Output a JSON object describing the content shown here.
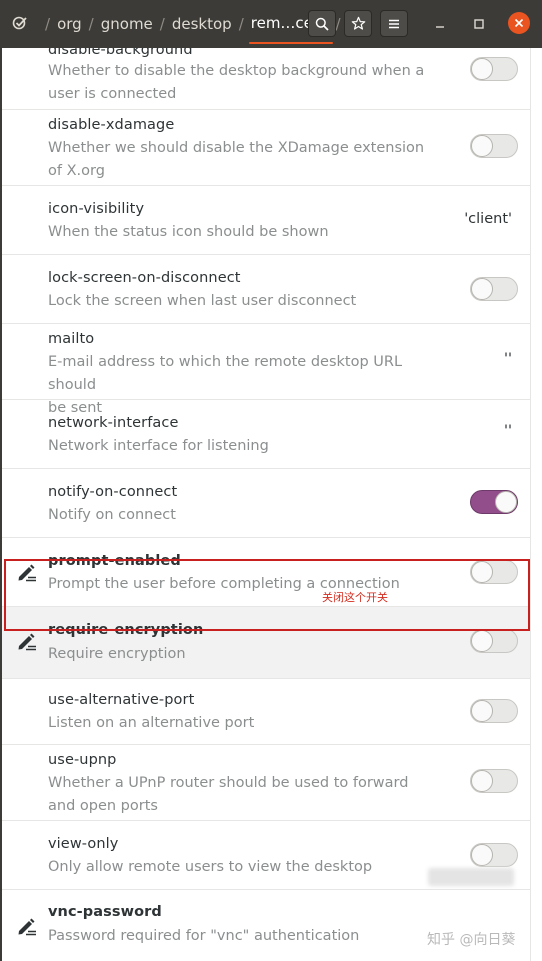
{
  "header": {
    "path": [
      "org",
      "gnome",
      "desktop"
    ],
    "current": "rem…cess",
    "search_icon": "search-icon",
    "star_icon": "star-icon",
    "menu_icon": "hamburger-menu-icon",
    "accent": "#e95420"
  },
  "rows": {
    "disable_background": {
      "name": "disable-background",
      "desc_line1": "Whether to disable the desktop background when a",
      "desc_line2": "user is connected",
      "state": "off"
    },
    "disable_xdamage": {
      "name": "disable-xdamage",
      "desc_line1": "Whether we should disable the XDamage extension",
      "desc_line2": "of X.org",
      "state": "off"
    },
    "icon_visibility": {
      "name": "icon-visibility",
      "desc": "When the status icon should be shown",
      "value": "'client'"
    },
    "lock_screen": {
      "name": "lock-screen-on-disconnect",
      "desc": "Lock the screen when last user disconnect",
      "state": "off"
    },
    "mailto": {
      "name": "mailto",
      "desc_line1": "E-mail address to which the remote desktop URL should",
      "desc_line2": "be sent",
      "value": "''"
    },
    "network_interface": {
      "name": "network-interface",
      "desc": "Network interface for listening",
      "value": "''"
    },
    "notify_on_connect": {
      "name": "notify-on-connect",
      "desc": "Notify on connect",
      "state": "on"
    },
    "prompt_enabled": {
      "name": "prompt-enabled",
      "desc": "Prompt the user before completing a connection",
      "state": "off"
    },
    "require_encryption": {
      "name": "require-encryption",
      "desc": "Require encryption",
      "state": "off",
      "annotation": "关闭这个开关"
    },
    "use_alternative_port": {
      "name": "use-alternative-port",
      "desc": "Listen on an alternative port",
      "state": "off"
    },
    "use_upnp": {
      "name": "use-upnp",
      "desc_line1": "Whether a UPnP router should be used to forward",
      "desc_line2": "and open ports",
      "state": "off"
    },
    "view_only": {
      "name": "view-only",
      "desc": "Only allow remote users to view the desktop",
      "state": "off"
    },
    "vnc_password": {
      "name": "vnc-password",
      "desc": "Password required for \"vnc\" authentication"
    }
  },
  "watermark": "知乎 @向日葵",
  "colors": {
    "toggle_on": "#924d8b",
    "highlight_border": "#c8201f",
    "header_bg": "#3c3b37"
  }
}
